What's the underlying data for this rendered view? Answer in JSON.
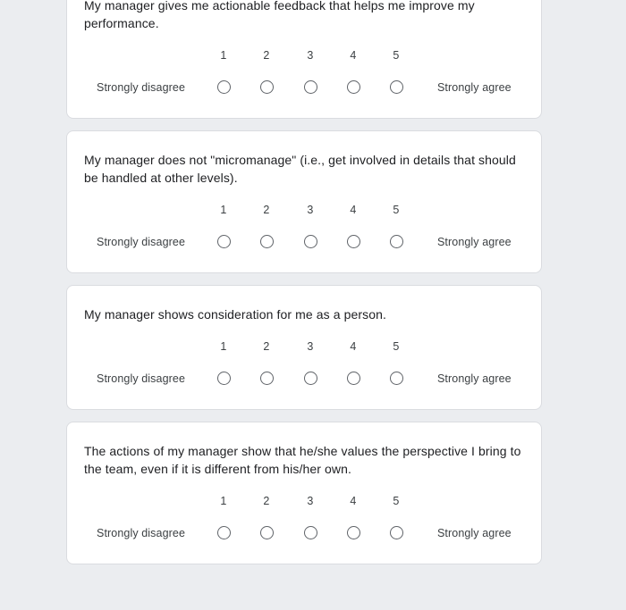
{
  "page": {
    "background_color": "#ebedf0",
    "card_background_color": "#ffffff",
    "text_color": "#202124"
  },
  "scale": {
    "numbers": [
      "1",
      "2",
      "3",
      "4",
      "5"
    ],
    "low_label": "Strongly disagree",
    "high_label": "Strongly agree",
    "selected": null
  },
  "questions": [
    {
      "id": "q-actionable-feedback",
      "text": "My manager gives me actionable feedback that helps me improve my performance."
    },
    {
      "id": "q-micromanage",
      "text": "My manager does not \"micromanage\" (i.e., get involved in details that should be handled at other levels)."
    },
    {
      "id": "q-consideration",
      "text": "My manager shows consideration for me as a person."
    },
    {
      "id": "q-values-perspective",
      "text": "The actions of my manager show that he/she values the perspective I bring to the team, even if it is different from his/her own."
    }
  ]
}
